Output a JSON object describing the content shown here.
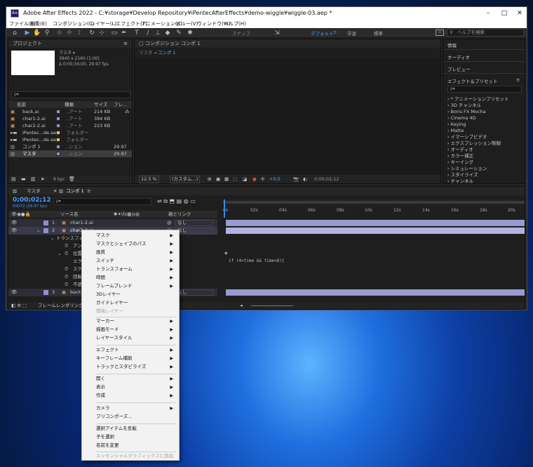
{
  "titlebar": {
    "app_icon": "Ae",
    "title": "Adobe After Effects 2022 - C:¥storage¥Develop Repository¥iPentecAfterEffects¥demo-wiggle¥wiggle-03.aep *",
    "minimize": "–",
    "maximize": "□",
    "close": "✕"
  },
  "menu": [
    "ファイル(F)",
    "編集(E)",
    "コンポジション(C)",
    "レイヤー(L)",
    "エフェクト(T)",
    "アニメーション(A)",
    "ビュー(V)",
    "ウィンドウ(W)",
    "ヘルプ(H)"
  ],
  "toolbar": {
    "snap_label": "スナップ",
    "workspaces": [
      "デフォルト",
      "学習",
      "標準"
    ],
    "help_search_placeholder": "ヘルプを検索"
  },
  "project": {
    "panel_title": "プロジェクト",
    "preview_name": "マスタ ▾",
    "preview_size": "3840 x 2160 (1.00)",
    "preview_duration": "Δ 0;00;34;00, 29.97 fps",
    "search_placeholder": "ρ▾",
    "columns": [
      "名前",
      "種類",
      "サイズ",
      "フレ..."
    ],
    "items": [
      {
        "name": "back.ai",
        "type": "..アート",
        "size": "214 KB",
        "fps": ""
      },
      {
        "name": "char1-2.ai",
        "type": "..アート",
        "size": "394 KB",
        "fps": ""
      },
      {
        "name": "char2-2.ai",
        "type": "..アート",
        "size": "223 KB",
        "fps": ""
      },
      {
        "name": "iPentec...de.aep",
        "type": "フォルダー",
        "size": "",
        "fps": ""
      },
      {
        "name": "iPentec...de.aep",
        "type": "フォルダー",
        "size": "",
        "fps": ""
      },
      {
        "name": "コンポ 1",
        "type": "..ション",
        "size": "",
        "fps": "29.97"
      },
      {
        "name": "マスタ",
        "type": "..ション",
        "size": "",
        "fps": "29.97"
      }
    ],
    "bpc": "8 bpc"
  },
  "composition": {
    "panel_title": "コンポジション コンポ 1",
    "breadcrumb_a": "マスタ",
    "breadcrumb_b": "コンポ 1",
    "zoom": "12.5 %",
    "quality": "(カスタム...)",
    "exposure": "+0.0",
    "timecode": "0;00;02;12"
  },
  "right": {
    "info": "情報",
    "audio": "オーディオ",
    "preview": "プレビュー",
    "effects_title": "エフェクト＆プリセット",
    "search_placeholder": "ρ▾",
    "effects": [
      "* アニメーションプリセット",
      "3D チャンネル",
      "Boris FX Mocha",
      "Cinema 4D",
      "Keying",
      "Matte",
      "イマーシブビデオ",
      "エクスプレッション制御",
      "オーディオ",
      "カラー補正",
      "キーイング",
      "シミュレーション",
      "スタイライズ",
      "チャンネル"
    ]
  },
  "timeline": {
    "tab_master": "マスタ",
    "tab_comp": "コンポ 1",
    "timecode": "0;00;02;12",
    "frames": "00072 (29.97 fps)",
    "search_placeholder": "ρ▾",
    "col_source": "ソース名",
    "col_parent": "親とリンク",
    "ruler": [
      "0s",
      "02s",
      "04s",
      "06s",
      "08s",
      "10s",
      "12s",
      "14s",
      "16s",
      "18s",
      "20s"
    ],
    "layers": [
      {
        "num": "1",
        "name": "char1-2.ai",
        "parent": "なし"
      },
      {
        "num": "2",
        "name": "char2-2.ai",
        "parent": "なし"
      },
      {
        "num": "3",
        "name": "back.ai",
        "parent": "なし"
      }
    ],
    "props": [
      "トランスフォーム",
      "アンカー",
      "位置",
      "エクスプ",
      "スケール",
      "回転",
      "不透明度"
    ],
    "position_prefix": "bc",
    "expression": "if (4<time && time<8){",
    "footer": "フレームレンダリング時"
  },
  "context_menu": [
    {
      "label": "マスク",
      "sub": true
    },
    {
      "label": "マスクとシェイプのパス",
      "sub": true
    },
    {
      "label": "画質",
      "sub": true
    },
    {
      "label": "スイッチ",
      "sub": true
    },
    {
      "label": "トランスフォーム",
      "sub": true
    },
    {
      "label": "時間",
      "sub": true
    },
    {
      "label": "フレームブレンド",
      "sub": true
    },
    {
      "label": "3Dレイヤー",
      "sub": false
    },
    {
      "label": "ガイドレイヤー",
      "sub": false
    },
    {
      "label": "環境レイヤー",
      "sub": false,
      "disabled": true
    },
    {
      "label": "マーカー",
      "sub": true
    },
    {
      "label": "描画モード",
      "sub": true
    },
    {
      "label": "レイヤースタイル",
      "sub": true
    },
    {
      "label": "エフェクト",
      "sub": true
    },
    {
      "label": "キーフレーム補助",
      "sub": true
    },
    {
      "label": "トラックとスタビライズ",
      "sub": true
    },
    {
      "label": "開く",
      "sub": true
    },
    {
      "label": "表示",
      "sub": true
    },
    {
      "label": "作成",
      "sub": true
    },
    {
      "label": "カメラ",
      "sub": true
    },
    {
      "label": "プリコンポーズ...",
      "sub": false
    },
    {
      "label": "選択アイテムを反転",
      "sub": false
    },
    {
      "label": "子を選択",
      "sub": false
    },
    {
      "label": "名前を変更",
      "sub": false
    },
    {
      "label": "エッセンシャルグラフィックスに追加",
      "sub": false,
      "disabled": true
    }
  ],
  "colors": {
    "accent": "#2d8ceb",
    "timeline_bar": "#9a9ad0",
    "menu_bg": "#f2f2f2"
  }
}
